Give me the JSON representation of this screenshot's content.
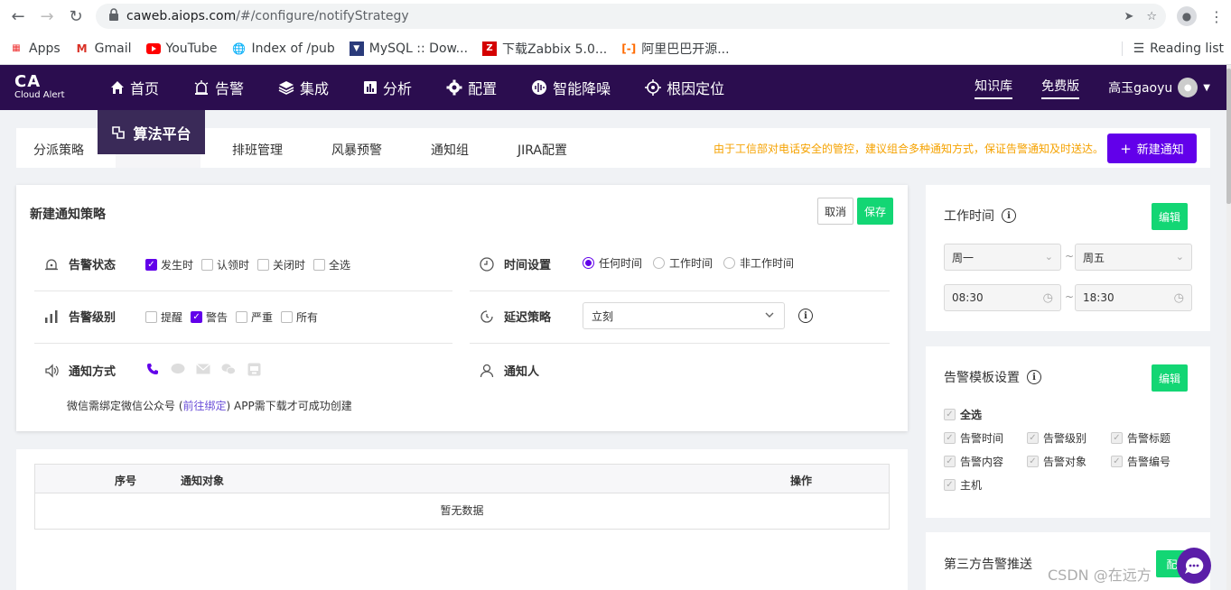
{
  "browser": {
    "url_host": "caweb.aiops.com",
    "url_path": "/#/configure/notifyStrategy",
    "bookmarks": [
      "Apps",
      "Gmail",
      "YouTube",
      "Index of /pub",
      "MySQL :: Dow...",
      "下载Zabbix 5.0...",
      "阿里巴巴开源..."
    ],
    "reading_list": "Reading list"
  },
  "header": {
    "logo_main": "CA",
    "logo_sub": "Cloud Alert",
    "nav": [
      "首页",
      "告警",
      "集成",
      "分析",
      "配置",
      "智能降噪",
      "根因定位"
    ],
    "knowledge": "知识库",
    "free": "免费版",
    "user": "高玉gaoyu",
    "algo_platform": "算法平台"
  },
  "subtabs": {
    "items": [
      "分派策略",
      "排班管理",
      "风暴预警",
      "通知组",
      "JIRA配置"
    ],
    "notice": "由于工信部对电话安全的管控，建议组合多种通知方式，保证告警通知及时送达。",
    "new_button": "新建通知"
  },
  "form": {
    "title": "新建通知策略",
    "cancel": "取消",
    "save": "保存",
    "alert_status_label": "告警状态",
    "alert_status_opts": [
      {
        "label": "发生时",
        "checked": true
      },
      {
        "label": "认领时",
        "checked": false
      },
      {
        "label": "关闭时",
        "checked": false
      },
      {
        "label": "全选",
        "checked": false
      }
    ],
    "time_label": "时间设置",
    "time_opts": [
      {
        "label": "任何时间",
        "checked": true
      },
      {
        "label": "工作时间",
        "checked": false
      },
      {
        "label": "非工作时间",
        "checked": false
      }
    ],
    "level_label": "告警级别",
    "level_opts": [
      {
        "label": "提醒",
        "checked": false
      },
      {
        "label": "警告",
        "checked": true
      },
      {
        "label": "严重",
        "checked": false
      },
      {
        "label": "所有",
        "checked": false
      }
    ],
    "delay_label": "延迟策略",
    "delay_value": "立刻",
    "notify_method_label": "通知方式",
    "notifier_label": "通知人",
    "wx_note_pre": "微信需绑定微信公众号 (",
    "wx_note_link": "前往绑定",
    "wx_note_post": ") APP需下载才可成功创建"
  },
  "table": {
    "columns": [
      "序号",
      "通知对象",
      "操作"
    ],
    "empty": "暂无数据"
  },
  "work_time": {
    "title": "工作时间",
    "edit": "编辑",
    "day_from": "周一",
    "day_to": "周五",
    "time_from": "08:30",
    "time_to": "18:30",
    "tilde": "~"
  },
  "template": {
    "title": "告警模板设置",
    "edit": "编辑",
    "all": "全选",
    "fields": [
      "告警时间",
      "告警级别",
      "告警标题",
      "告警内容",
      "告警对象",
      "告警编号",
      "主机"
    ]
  },
  "third_party": {
    "title": "第三方告警推送",
    "button": "配"
  },
  "watermark": "CSDN @在远方",
  "colors": {
    "header_bg": "#2b0d4f",
    "accent_purple": "#6200ea",
    "save_green": "#13d674",
    "notice_orange": "#f5a200"
  }
}
